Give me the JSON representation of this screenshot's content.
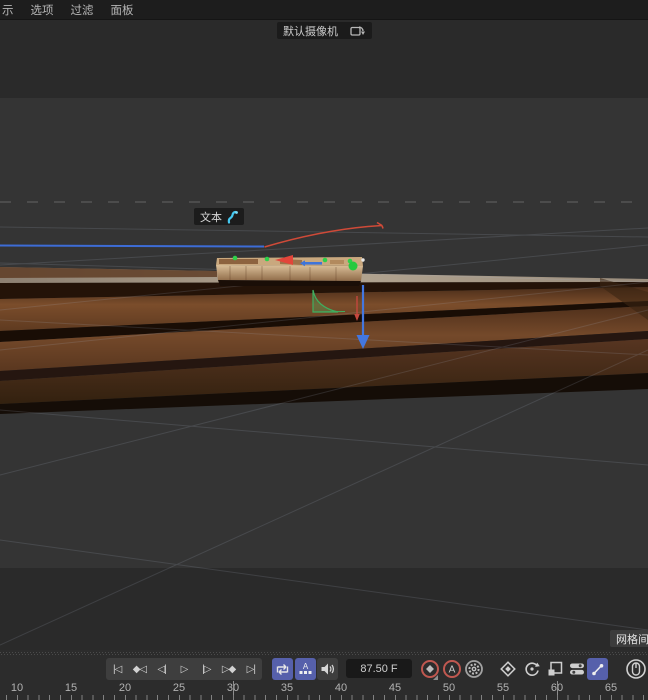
{
  "menubar": {
    "items": [
      "示",
      "选项",
      "过滤",
      "面板"
    ]
  },
  "viewport": {
    "camera_label": "默认摄像机",
    "object_label": "文本",
    "grid_hud_label": "网格间距"
  },
  "timeline": {
    "transport": [
      {
        "name": "go-to-start",
        "glyph": "|◁"
      },
      {
        "name": "previous-key",
        "glyph": "◆◁"
      },
      {
        "name": "previous-frame",
        "glyph": "◁|"
      },
      {
        "name": "play",
        "glyph": "▷"
      },
      {
        "name": "next-frame",
        "glyph": "|▷"
      },
      {
        "name": "next-key",
        "glyph": "▷◆"
      },
      {
        "name": "go-to-end",
        "glyph": "▷|"
      }
    ],
    "frame_field_value": "87.50 F",
    "ruler": {
      "frames": [
        "10",
        "15",
        "20",
        "25",
        "30",
        "35",
        "40",
        "45",
        "50",
        "55",
        "60",
        "65"
      ],
      "marker_frames": [
        30,
        60
      ]
    }
  },
  "icons": {
    "autokey_letter": "A",
    "keyframe_selection_letter": "A"
  },
  "colors": {
    "accent_blue": "#5660ab",
    "record_red": "#c05850",
    "axis_green": "#4ec87a",
    "axis_blue": "#3d6cd6",
    "axis_red": "#cf4a38",
    "plank_brown": "#6f4627"
  }
}
